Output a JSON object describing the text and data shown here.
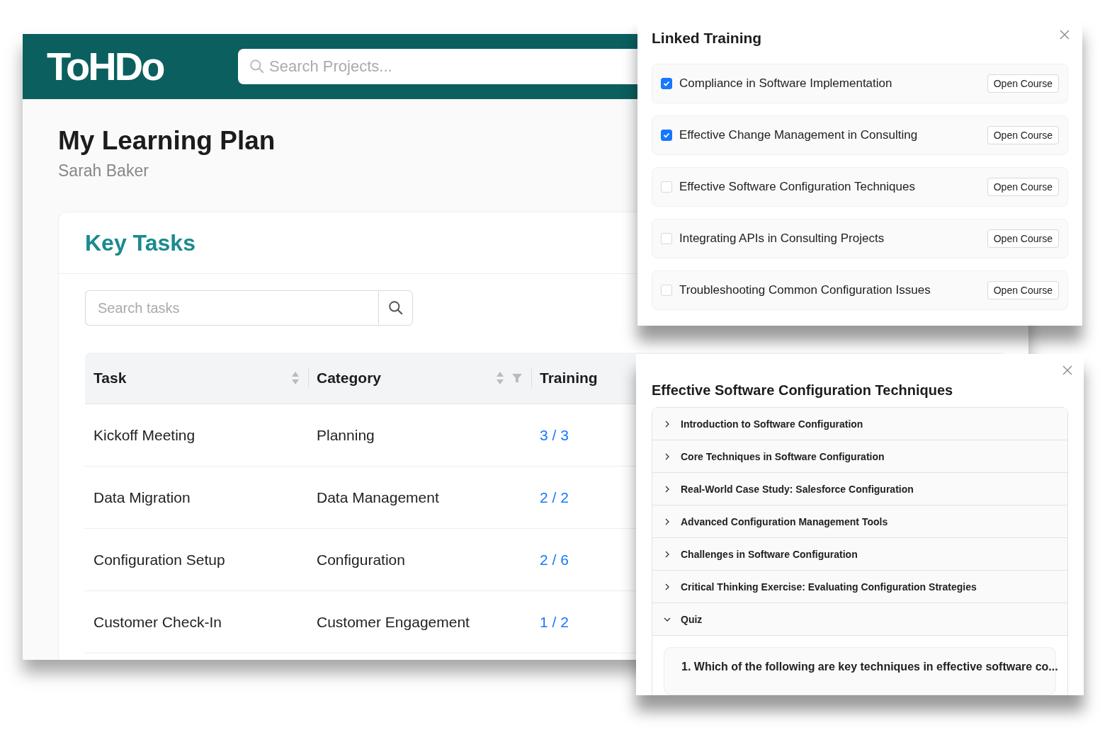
{
  "header": {
    "logo": "ToHDo",
    "search": {
      "placeholder": "Search Projects..."
    }
  },
  "page": {
    "title": "My Learning Plan",
    "subtitle": "Sarah Baker"
  },
  "card": {
    "title": "Key Tasks",
    "search": {
      "placeholder": "Search tasks"
    },
    "table": {
      "columns": [
        {
          "label": "Task",
          "sortable": true,
          "filterable": false
        },
        {
          "label": "Category",
          "sortable": true,
          "filterable": true
        },
        {
          "label": "Training",
          "sortable": false,
          "filterable": false
        }
      ],
      "rows": [
        {
          "task": "Kickoff Meeting",
          "category": "Planning",
          "training": "3 / 3"
        },
        {
          "task": "Data Migration",
          "category": "Data Management",
          "training": "2 / 2"
        },
        {
          "task": "Configuration Setup",
          "category": "Configuration",
          "training": "2 / 6"
        },
        {
          "task": "Customer Check-In",
          "category": "Customer Engagement",
          "training": "1 / 2"
        }
      ]
    }
  },
  "linked_training": {
    "title": "Linked Training",
    "items": [
      {
        "label": "Compliance in Software Implementation",
        "checked": true,
        "button": "Open Course"
      },
      {
        "label": "Effective Change Management in Consulting",
        "checked": true,
        "button": "Open Course"
      },
      {
        "label": "Effective Software Configuration Techniques",
        "checked": false,
        "button": "Open Course"
      },
      {
        "label": "Integrating APIs in Consulting Projects",
        "checked": false,
        "button": "Open Course"
      },
      {
        "label": "Troubleshooting Common Configuration Issues",
        "checked": false,
        "button": "Open Course"
      }
    ]
  },
  "course": {
    "title": "Effective Software Configuration Techniques",
    "sections": [
      {
        "label": "Introduction to Software Configuration",
        "expanded": false
      },
      {
        "label": "Core Techniques in Software Configuration",
        "expanded": false
      },
      {
        "label": "Real-World Case Study: Salesforce Configuration",
        "expanded": false
      },
      {
        "label": "Advanced Configuration Management Tools",
        "expanded": false
      },
      {
        "label": "Challenges in Software Configuration",
        "expanded": false
      },
      {
        "label": "Critical Thinking Exercise: Evaluating Configuration Strategies",
        "expanded": false
      },
      {
        "label": "Quiz",
        "expanded": true,
        "questions": [
          "1. Which of the following are key techniques in effective software co..."
        ]
      }
    ]
  }
}
